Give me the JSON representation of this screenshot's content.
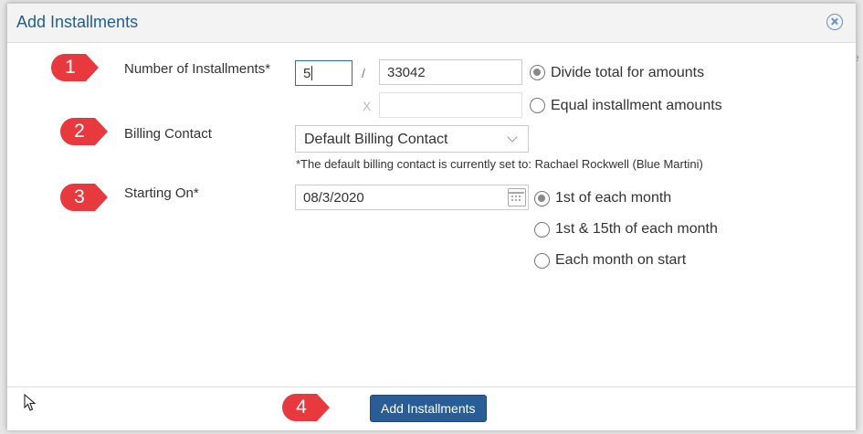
{
  "background": {
    "edge_hint": "e"
  },
  "dialog": {
    "title": "Add Installments",
    "close_icon": "close-circle-icon",
    "footer": {
      "submit_label": "Add Installments"
    }
  },
  "steps": [
    "1",
    "2",
    "3",
    "4"
  ],
  "form": {
    "installments": {
      "label": "Number of Installments*",
      "count_value": "5",
      "divider": "/",
      "total_value": "33042",
      "multiplier": "X",
      "amount_value": "",
      "options": [
        {
          "label": "Divide total for amounts",
          "checked": true
        },
        {
          "label": "Equal installment amounts",
          "checked": false
        }
      ]
    },
    "billing": {
      "label": "Billing Contact",
      "selected": "Default Billing Contact",
      "hint": "*The default billing contact is currently set to: Rachael Rockwell (Blue Martini)"
    },
    "starting": {
      "label": "Starting On*",
      "date_value": "08/3/2020",
      "options": [
        {
          "label": "1st of each month",
          "checked": true
        },
        {
          "label": "1st & 15th of each month",
          "checked": false
        },
        {
          "label": "Each month on start",
          "checked": false
        }
      ]
    }
  },
  "colors": {
    "badge": "#e8393f",
    "primary": "#2a5d95",
    "title": "#1f5e94"
  }
}
